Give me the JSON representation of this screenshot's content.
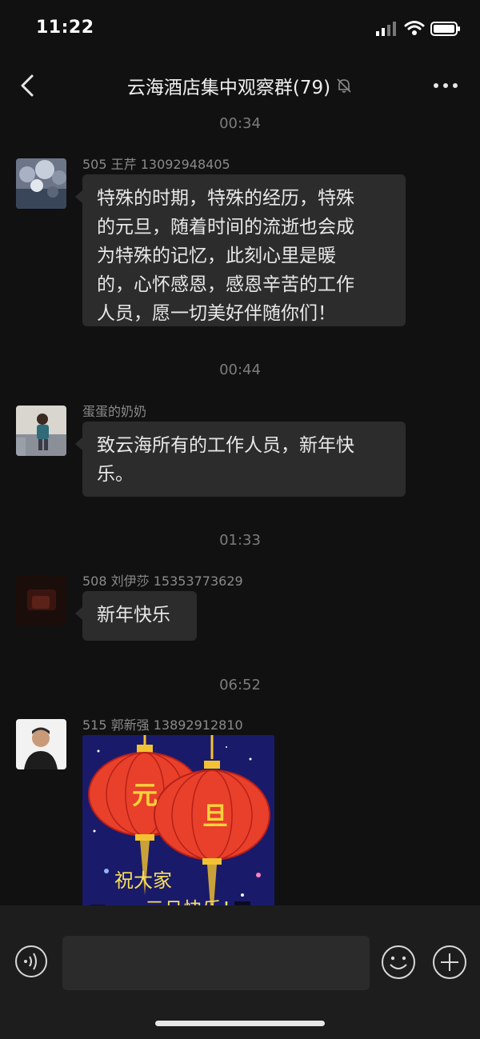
{
  "status_bar": {
    "time": "11:22"
  },
  "header": {
    "title": "云海酒店集中观察群(79)"
  },
  "messages": [
    {
      "time": "00:34",
      "sender": "505 王芹 13092948405",
      "lines": [
        "特殊的时期，特殊的经历，特殊",
        "的元旦，随着时间的流逝也会成",
        "为特殊的记忆，此刻心里是暖",
        "的，心怀感恩，感恩辛苦的工作",
        "人员，愿一切美好伴随你们！"
      ]
    },
    {
      "time": "00:44",
      "sender": "蛋蛋的奶奶",
      "lines": [
        "致云海所有的工作人员，新年快",
        "乐。"
      ]
    },
    {
      "time": "01:33",
      "sender": "508 刘伊莎 15353773629",
      "lines": [
        "新年快乐"
      ]
    },
    {
      "time": "06:52",
      "sender": "515 郭新强 13892912810",
      "image": {
        "lantern_left": "元",
        "lantern_right": "旦",
        "greeting_line1": "祝大家",
        "greeting_line2": "元旦快乐！"
      }
    }
  ],
  "input_bar": {
    "placeholder": ""
  },
  "colors": {
    "background": "#111111",
    "bubble": "#2c2c2c",
    "input_bar": "#1d1d1d",
    "lantern": "#e8402a",
    "image_sky": "#1a1a6a"
  },
  "icons": [
    "back-icon",
    "mute-icon",
    "more-icon",
    "voice-icon",
    "emoji-icon",
    "add-icon",
    "signal-icon",
    "wifi-icon",
    "battery-icon"
  ]
}
